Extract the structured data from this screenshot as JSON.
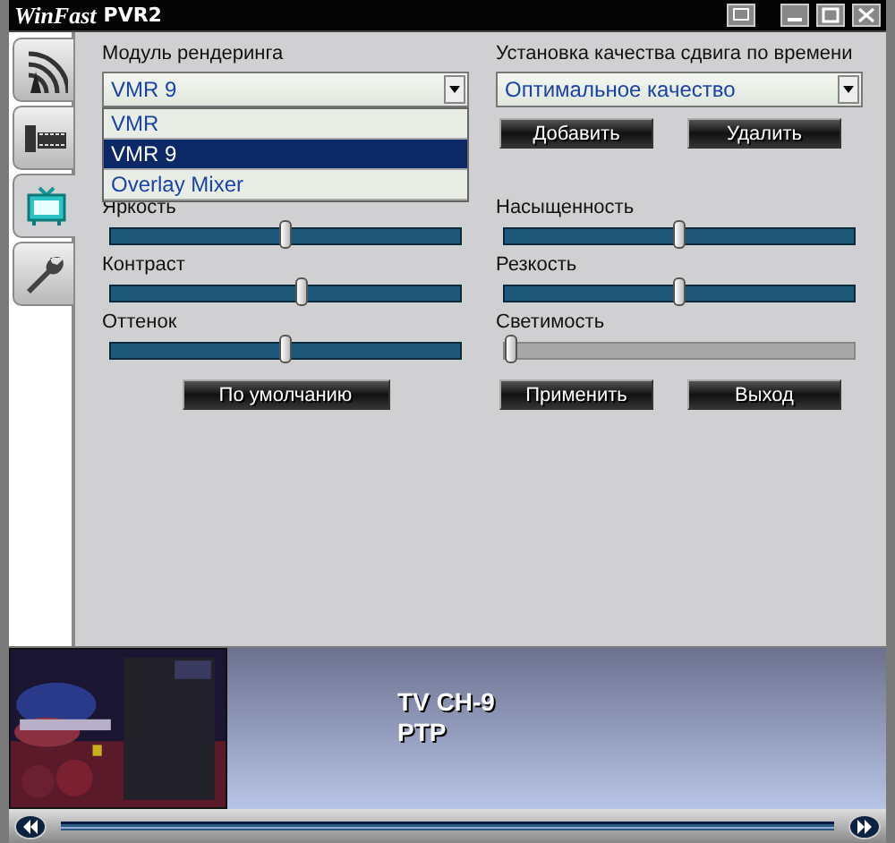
{
  "window": {
    "title_brand": "WinFast",
    "title_product": "PVR2"
  },
  "tabs": [
    {
      "kind": "signal",
      "selected": false
    },
    {
      "kind": "film",
      "selected": false
    },
    {
      "kind": "tv",
      "selected": true
    },
    {
      "kind": "wrench",
      "selected": false
    }
  ],
  "renderer": {
    "label": "Модуль рендеринга",
    "value": "VMR 9",
    "expanded": true,
    "options": [
      {
        "label": "VMR",
        "selected": false
      },
      {
        "label": "VMR 9",
        "selected": true
      },
      {
        "label": "Overlay Mixer",
        "selected": false
      }
    ]
  },
  "timeshift": {
    "label": "Установка качества сдвига по времени",
    "value": "Оптимальное качество"
  },
  "timeshift_buttons": [
    "Добавить",
    "Удалить"
  ],
  "sliders": [
    {
      "label": "Яркость",
      "level": 0.5,
      "disabled": false
    },
    {
      "label": "Насыщенность",
      "level": 0.5,
      "disabled": false
    },
    {
      "label": "Контраст",
      "level": 0.55,
      "disabled": false
    },
    {
      "label": "Резкость",
      "level": 0.5,
      "disabled": false
    },
    {
      "label": "Оттенок",
      "level": 0.5,
      "disabled": false
    },
    {
      "label": "Светимость",
      "level": 0.02,
      "disabled": true
    }
  ],
  "default_button": "По умолчанию",
  "action_buttons": [
    "Применить",
    "Выход"
  ],
  "preview": {
    "channel": "TV CH-9",
    "program": "PTP"
  }
}
